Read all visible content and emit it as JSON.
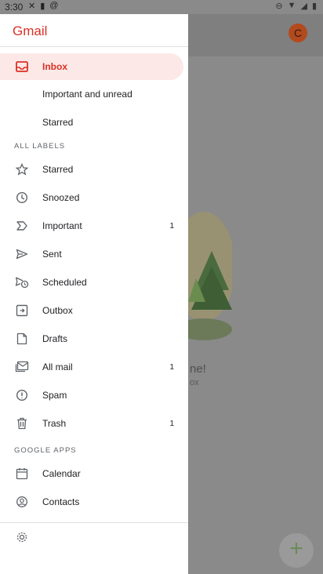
{
  "status_bar": {
    "time": "3:30"
  },
  "drawer": {
    "logo": "Gmail",
    "primary": [
      {
        "label": "Inbox",
        "icon": "inbox-icon",
        "selected": true
      },
      {
        "label": "Important and unread"
      },
      {
        "label": "Starred"
      }
    ],
    "all_labels_header": "ALL LABELS",
    "labels": [
      {
        "label": "Starred",
        "icon": "star-icon",
        "count": ""
      },
      {
        "label": "Snoozed",
        "icon": "clock-icon",
        "count": ""
      },
      {
        "label": "Important",
        "icon": "important-icon",
        "count": "1"
      },
      {
        "label": "Sent",
        "icon": "send-icon",
        "count": ""
      },
      {
        "label": "Scheduled",
        "icon": "scheduled-send-icon",
        "count": ""
      },
      {
        "label": "Outbox",
        "icon": "outbox-icon",
        "count": ""
      },
      {
        "label": "Drafts",
        "icon": "draft-icon",
        "count": ""
      },
      {
        "label": "All mail",
        "icon": "all-mail-icon",
        "count": "1"
      },
      {
        "label": "Spam",
        "icon": "spam-icon",
        "count": ""
      },
      {
        "label": "Trash",
        "icon": "trash-icon",
        "count": "1"
      }
    ],
    "google_apps_header": "GOOGLE APPS",
    "apps": [
      {
        "label": "Calendar",
        "icon": "calendar-icon"
      },
      {
        "label": "Contacts",
        "icon": "contacts-icon"
      }
    ]
  },
  "background": {
    "avatar_letter": "C",
    "text_fragment": "ne!",
    "subtext_fragment": "ox",
    "fab_symbol": "+"
  },
  "colors": {
    "accent": "#d93025",
    "selected_bg": "#fce8e6",
    "icon_gray": "#5f6368"
  }
}
